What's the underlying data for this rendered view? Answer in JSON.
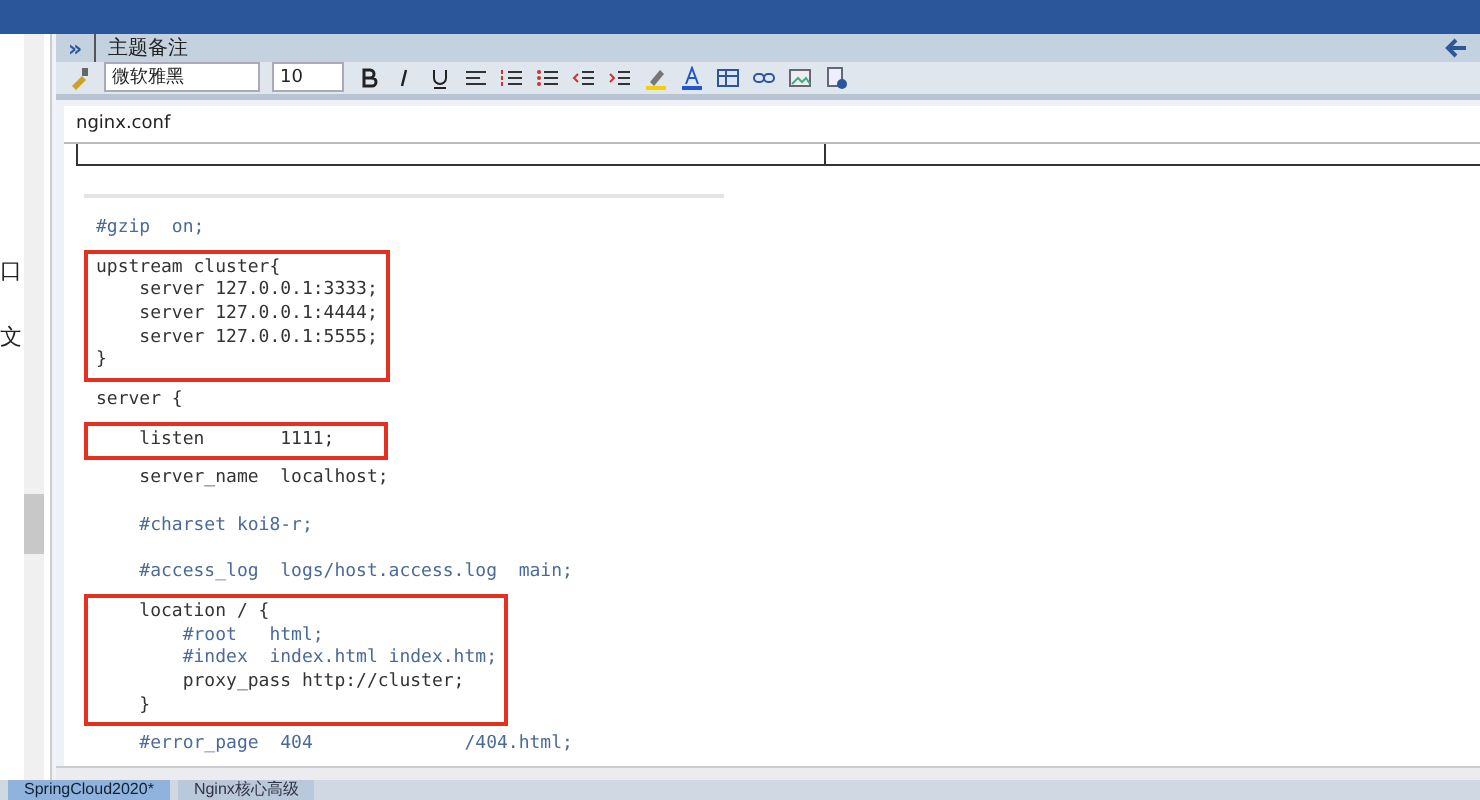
{
  "left_panel": {
    "fragments": [
      "口",
      "文"
    ]
  },
  "note_panel": {
    "expand_glyph": "»",
    "title": "主题备注",
    "toolbar": {
      "font": "微软雅黑",
      "size": "10"
    }
  },
  "document": {
    "file_label": "nginx.conf",
    "blocks": [
      {
        "highlighted": false,
        "lines": [
          {
            "kind": "comment",
            "text": "#gzip  on;"
          }
        ]
      },
      {
        "highlighted": true,
        "lines": [
          {
            "kind": "code",
            "text": "upstream cluster{"
          },
          {
            "kind": "code",
            "text": "    server 127.0.0.1:3333;"
          },
          {
            "kind": "code",
            "text": "    server 127.0.0.1:4444;"
          },
          {
            "kind": "code",
            "text": "    server 127.0.0.1:5555;"
          },
          {
            "kind": "code",
            "text": "}"
          }
        ]
      },
      {
        "highlighted": false,
        "lines": [
          {
            "kind": "code",
            "text": "server {"
          }
        ]
      },
      {
        "highlighted": true,
        "lines": [
          {
            "kind": "code",
            "text": "    listen       1111;"
          }
        ]
      },
      {
        "highlighted": false,
        "lines": [
          {
            "kind": "code",
            "text": "    server_name  localhost;"
          },
          {
            "kind": "blank"
          },
          {
            "kind": "comment",
            "text": "    #charset koi8-r;"
          },
          {
            "kind": "blank"
          },
          {
            "kind": "comment",
            "text": "    #access_log  logs/host.access.log  main;"
          }
        ]
      },
      {
        "highlighted": true,
        "lines": [
          {
            "kind": "code",
            "text": "    location / {"
          },
          {
            "kind": "comment",
            "text": "        #root   html;"
          },
          {
            "kind": "comment",
            "text": "        #index  index.html index.htm;"
          },
          {
            "kind": "code",
            "text": "        proxy_pass http://cluster;"
          },
          {
            "kind": "code",
            "text": "    }"
          }
        ]
      },
      {
        "highlighted": false,
        "lines": [
          {
            "kind": "comment",
            "text": "    #error_page  404              /404.html;"
          }
        ]
      }
    ]
  },
  "taskbar": {
    "tabs": [
      {
        "label": "SpringCloud2020*",
        "selected": true
      },
      {
        "label": "Nginx核心高级",
        "selected": false
      }
    ]
  }
}
